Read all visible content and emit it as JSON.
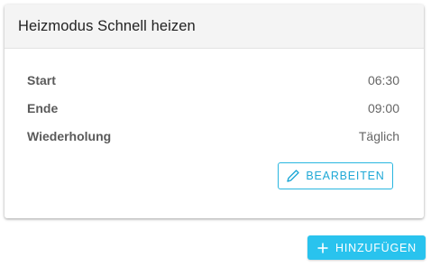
{
  "card": {
    "title": "Heizmodus Schnell heizen",
    "rows": [
      {
        "label": "Start",
        "value": "06:30"
      },
      {
        "label": "Ende",
        "value": "09:00"
      },
      {
        "label": "Wiederholung",
        "value": "Täglich"
      }
    ],
    "edit_label": "BEARBEITEN",
    "edit_icon": "pencil-icon"
  },
  "add_button": {
    "label": "HINZUFÜGEN",
    "icon": "plus-icon"
  },
  "colors": {
    "accent": "#29c3ee",
    "accent_outline": "#29b6e0",
    "header_bg": "#f4f4f4"
  }
}
